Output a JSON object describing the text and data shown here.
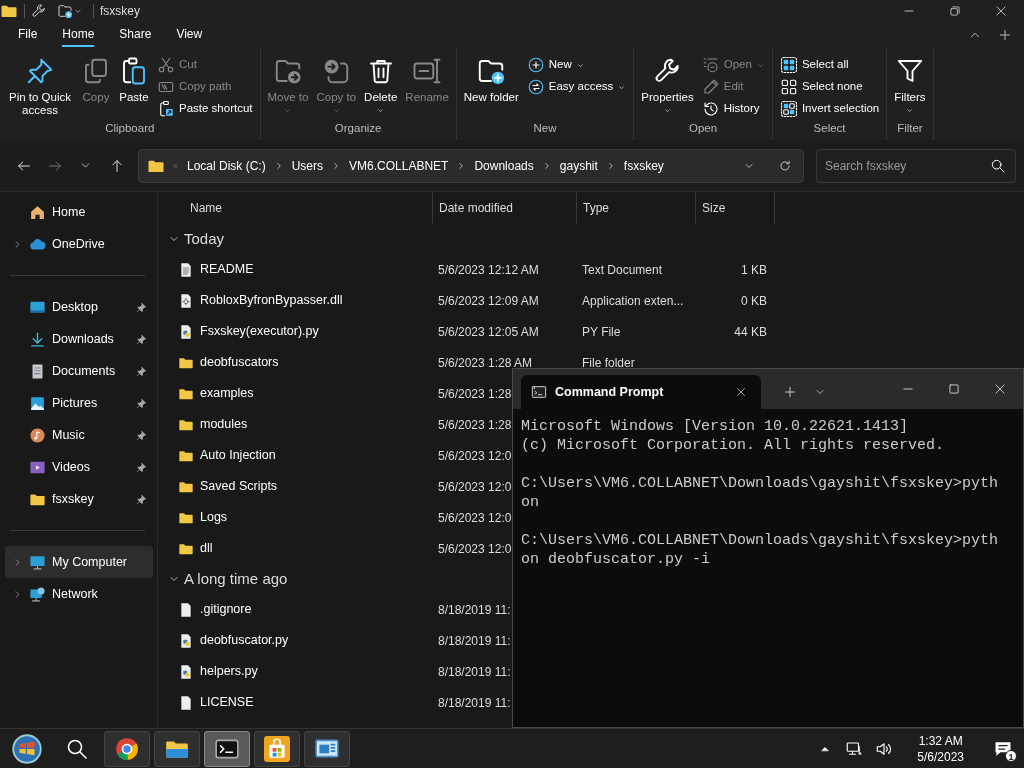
{
  "title_bar": {
    "title": "fsxskey"
  },
  "ribbon_tabs": [
    {
      "label": "File",
      "selected": false
    },
    {
      "label": "Home",
      "selected": true
    },
    {
      "label": "Share",
      "selected": false
    },
    {
      "label": "View",
      "selected": false
    }
  ],
  "ribbon_groups": [
    {
      "label": "Clipboard",
      "buttons": [
        {
          "kind": "large",
          "label": "Pin to Quick access",
          "disabled": false,
          "dropdown": false
        },
        {
          "kind": "large",
          "label": "Copy",
          "disabled": true,
          "dropdown": false
        },
        {
          "kind": "large",
          "label": "Paste",
          "disabled": false,
          "dropdown": false
        },
        {
          "kind": "small",
          "label": "Cut",
          "disabled": true,
          "dropdown": false
        },
        {
          "kind": "small",
          "label": "Copy path",
          "disabled": true,
          "dropdown": false
        },
        {
          "kind": "small",
          "label": "Paste shortcut",
          "disabled": false,
          "dropdown": false
        }
      ]
    },
    {
      "label": "Organize",
      "buttons": [
        {
          "kind": "large",
          "label": "Move to",
          "disabled": true,
          "dropdown": true
        },
        {
          "kind": "large",
          "label": "Copy to",
          "disabled": true,
          "dropdown": true
        },
        {
          "kind": "large",
          "label": "Delete",
          "disabled": false,
          "dropdown": true
        },
        {
          "kind": "large",
          "label": "Rename",
          "disabled": true,
          "dropdown": false
        }
      ]
    },
    {
      "label": "New",
      "buttons": [
        {
          "kind": "large",
          "label": "New folder",
          "disabled": false,
          "dropdown": false
        },
        {
          "kind": "small",
          "label": "New",
          "disabled": false,
          "dropdown": true
        },
        {
          "kind": "small",
          "label": "Easy access",
          "disabled": false,
          "dropdown": true
        }
      ]
    },
    {
      "label": "Open",
      "buttons": [
        {
          "kind": "large",
          "label": "Properties",
          "disabled": false,
          "dropdown": true
        },
        {
          "kind": "small",
          "label": "Open",
          "disabled": true,
          "dropdown": true
        },
        {
          "kind": "small",
          "label": "Edit",
          "disabled": true,
          "dropdown": false
        },
        {
          "kind": "small",
          "label": "History",
          "disabled": false,
          "dropdown": false
        }
      ]
    },
    {
      "label": "Select",
      "buttons": [
        {
          "kind": "small",
          "label": "Select all",
          "disabled": false,
          "dropdown": false
        },
        {
          "kind": "small",
          "label": "Select none",
          "disabled": false,
          "dropdown": false
        },
        {
          "kind": "small",
          "label": "Invert selection",
          "disabled": false,
          "dropdown": false
        }
      ]
    },
    {
      "label": "Filter",
      "buttons": [
        {
          "kind": "large",
          "label": "Filters",
          "disabled": false,
          "dropdown": true
        }
      ]
    }
  ],
  "address_bar": {
    "path": [
      "Local Disk (C:)",
      "Users",
      "VM6.COLLABNET",
      "Downloads",
      "gayshit",
      "fsxskey"
    ]
  },
  "search": {
    "placeholder": "Search fsxskey"
  },
  "navigation_pane": {
    "sections": [
      {
        "items": [
          {
            "label": "Home",
            "expandable": false,
            "pinned": false,
            "selected": false
          },
          {
            "label": "OneDrive",
            "expandable": true,
            "pinned": false,
            "selected": false
          }
        ]
      },
      {
        "items": [
          {
            "label": "Desktop",
            "expandable": false,
            "pinned": true,
            "selected": false
          },
          {
            "label": "Downloads",
            "expandable": false,
            "pinned": true,
            "selected": false
          },
          {
            "label": "Documents",
            "expandable": false,
            "pinned": true,
            "selected": false
          },
          {
            "label": "Pictures",
            "expandable": false,
            "pinned": true,
            "selected": false
          },
          {
            "label": "Music",
            "expandable": false,
            "pinned": true,
            "selected": false
          },
          {
            "label": "Videos",
            "expandable": false,
            "pinned": true,
            "selected": false
          },
          {
            "label": "fsxskey",
            "expandable": false,
            "pinned": true,
            "selected": false
          }
        ]
      },
      {
        "items": [
          {
            "label": "My Computer",
            "expandable": true,
            "pinned": false,
            "selected": true
          },
          {
            "label": "Network",
            "expandable": true,
            "pinned": false,
            "selected": false
          }
        ]
      }
    ]
  },
  "file_list": {
    "columns": [
      "Name",
      "Date modified",
      "Type",
      "Size"
    ],
    "groups": [
      {
        "label": "Today",
        "expanded": true,
        "rows": [
          {
            "kind": "text",
            "name": "README",
            "date_modified": "5/6/2023 12:12 AM",
            "type": "Text Document",
            "size": "1 KB"
          },
          {
            "kind": "dll",
            "name": "RobloxByfronBypasser.dll",
            "date_modified": "5/6/2023 12:09 AM",
            "type": "Application exten...",
            "size": "0 KB"
          },
          {
            "kind": "python",
            "name": "Fsxskey(executor).py",
            "date_modified": "5/6/2023 12:05 AM",
            "type": "PY File",
            "size": "44 KB"
          },
          {
            "kind": "folder",
            "name": "deobfuscators",
            "date_modified": "5/6/2023 1:28 AM",
            "type": "File folder"
          },
          {
            "kind": "folder",
            "name": "examples",
            "date_modified": "5/6/2023 1:28"
          },
          {
            "kind": "folder",
            "name": "modules",
            "date_modified": "5/6/2023 1:28"
          },
          {
            "kind": "folder",
            "name": "Auto Injection",
            "date_modified": "5/6/2023 12:0"
          },
          {
            "kind": "folder",
            "name": "Saved Scripts",
            "date_modified": "5/6/2023 12:0"
          },
          {
            "kind": "folder",
            "name": "Logs",
            "date_modified": "5/6/2023 12:0"
          },
          {
            "kind": "folder",
            "name": "dll",
            "date_modified": "5/6/2023 12:0"
          }
        ]
      },
      {
        "label": "A long time ago",
        "expanded": true,
        "rows": [
          {
            "kind": "file",
            "name": ".gitignore",
            "date_modified": "8/18/2019 11:"
          },
          {
            "kind": "python",
            "name": "deobfuscator.py",
            "date_modified": "8/18/2019 11:"
          },
          {
            "kind": "python",
            "name": "helpers.py",
            "date_modified": "8/18/2019 11:"
          },
          {
            "kind": "file",
            "name": "LICENSE",
            "date_modified": "8/18/2019 11:"
          }
        ]
      }
    ]
  },
  "console_window": {
    "tab_title": "Command Prompt",
    "blocks": [
      {
        "lines": [
          "Microsoft Windows [Version 10.0.22621.1413]",
          "(c) Microsoft Corporation. All rights reserved."
        ]
      },
      {
        "lines": [
          "C:\\Users\\VM6.COLLABNET\\Downloads\\gayshit\\fsxskey>pyth",
          "on"
        ]
      },
      {
        "lines": [
          "C:\\Users\\VM6.COLLABNET\\Downloads\\gayshit\\fsxskey>pyth",
          "on deobfuscator.py -i"
        ]
      }
    ]
  },
  "taskbar": {
    "apps": [
      {
        "active": false
      },
      {
        "active": false
      },
      {
        "active": true
      },
      {
        "active": false
      },
      {
        "active": false
      }
    ],
    "clock": {
      "time": "1:32 AM",
      "date": "5/6/2023"
    },
    "notifications": {
      "count": "1"
    }
  }
}
